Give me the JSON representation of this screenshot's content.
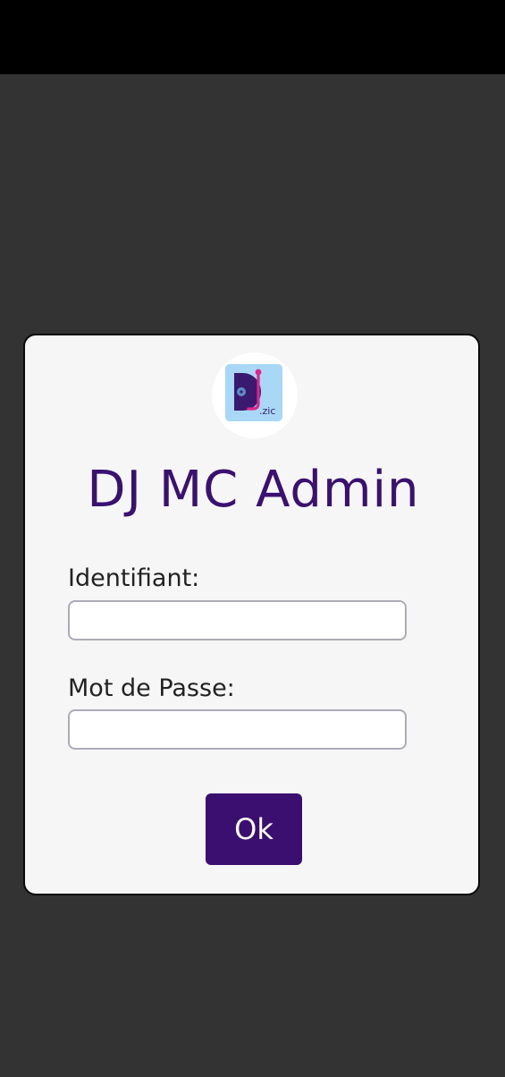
{
  "app": {
    "title": "DJ MC Admin",
    "logo_text": ".zic",
    "icon": "dj-zic-logo-icon"
  },
  "form": {
    "username_label": "Identifiant:",
    "username_value": "",
    "password_label": "Mot de Passe:",
    "password_value": "",
    "submit_label": "Ok"
  },
  "colors": {
    "background": "#333333",
    "status_bar": "#000000",
    "card": "#f6f6f7",
    "accent": "#3a0f70",
    "logo_tile": "#a8d8f6",
    "logo_pink": "#e0248c"
  }
}
